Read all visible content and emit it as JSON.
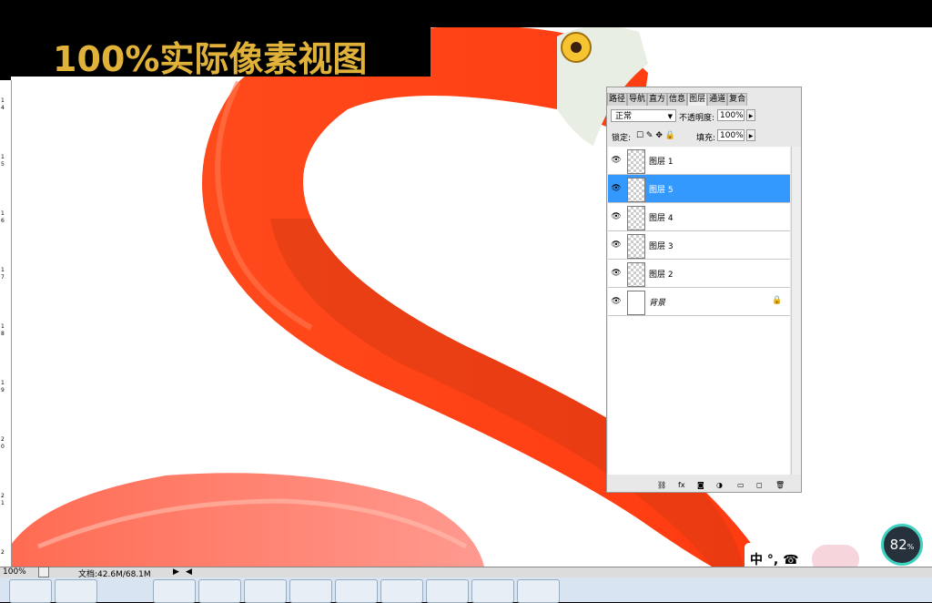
{
  "overlay": {
    "title": "100%实际像素视图"
  },
  "ruler": {
    "marks": [
      "1",
      "4",
      "1",
      "5",
      "1",
      "6",
      "1",
      "7",
      "1",
      "8",
      "1",
      "9",
      "2",
      "0",
      "2",
      "1",
      "2"
    ]
  },
  "panel": {
    "tabs": [
      "路径",
      "导航",
      "直方",
      "信息",
      "图层",
      "通道",
      "复合"
    ],
    "active_tab": "图层",
    "blend_mode": "正常",
    "opacity_label": "不透明度:",
    "opacity_value": "100%",
    "lock_label": "锁定:",
    "fill_label": "填充:",
    "fill_value": "100%",
    "layers": [
      {
        "name": "图层 1",
        "selected": false
      },
      {
        "name": "图层 5",
        "selected": true
      },
      {
        "name": "图层 4",
        "selected": false
      },
      {
        "name": "图层 3",
        "selected": false
      },
      {
        "name": "图层 2",
        "selected": false
      },
      {
        "name": "背景",
        "selected": false,
        "locked": true
      }
    ],
    "footer_icons": [
      "link-icon",
      "fx-icon",
      "mask-icon",
      "adjustment-icon",
      "folder-icon",
      "new-layer-icon",
      "trash-icon"
    ]
  },
  "status": {
    "zoom": "100%",
    "doc": "文档:42.6M/68.1M"
  },
  "badge": {
    "value": "82",
    "unit": "%"
  },
  "sticker": {
    "text": "中 °, ☎"
  },
  "colors": {
    "flamingo": "#ff3a14",
    "flamingo_dark": "#d92a0c",
    "title_gold": "#e0b23a",
    "selected": "#3399ff"
  }
}
